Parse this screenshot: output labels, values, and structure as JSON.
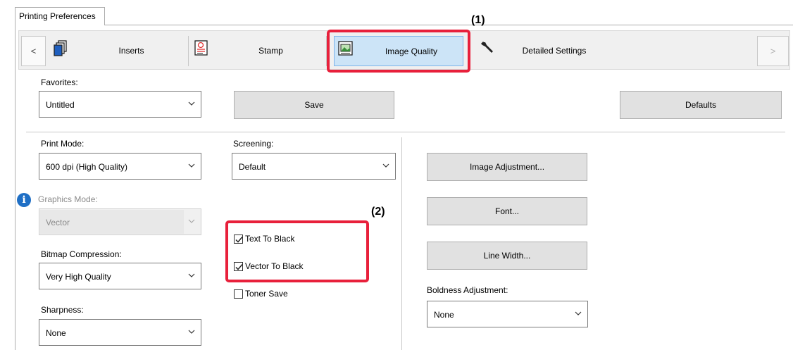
{
  "window": {
    "tab_title": "Printing Preferences"
  },
  "tabs": {
    "prev": "<",
    "next": ">",
    "items": [
      {
        "label": "Inserts",
        "icon": "inserts-icon"
      },
      {
        "label": "Stamp",
        "icon": "stamp-icon"
      },
      {
        "label": "Image Quality",
        "icon": "image-quality-icon",
        "selected": true
      },
      {
        "label": "Detailed Settings",
        "icon": "wrench-icon"
      }
    ]
  },
  "annotations": {
    "one": "(1)",
    "two": "(2)"
  },
  "favorites": {
    "label": "Favorites:",
    "value": "Untitled",
    "save": "Save",
    "defaults": "Defaults"
  },
  "print_mode": {
    "label": "Print Mode:",
    "value": "600 dpi (High Quality)"
  },
  "screening": {
    "label": "Screening:",
    "value": "Default"
  },
  "graphics_mode": {
    "label": "Graphics Mode:",
    "value": "Vector",
    "enabled": false
  },
  "bitmap_compression": {
    "label": "Bitmap Compression:",
    "value": "Very High Quality"
  },
  "sharpness": {
    "label": "Sharpness:",
    "value": "None"
  },
  "checkboxes": {
    "text_to_black": {
      "label": "Text To Black",
      "checked": true
    },
    "vector_to_black": {
      "label": "Vector To Black",
      "checked": true
    },
    "toner_save": {
      "label": "Toner Save",
      "checked": false
    }
  },
  "buttons": {
    "image_adjustment": "Image Adjustment...",
    "font": "Font...",
    "line_width": "Line Width..."
  },
  "boldness": {
    "label": "Boldness Adjustment:",
    "value": "None"
  },
  "colors": {
    "highlight": "#e8203b",
    "selected_tab": "#cce4f7",
    "info": "#1f6fc5"
  }
}
